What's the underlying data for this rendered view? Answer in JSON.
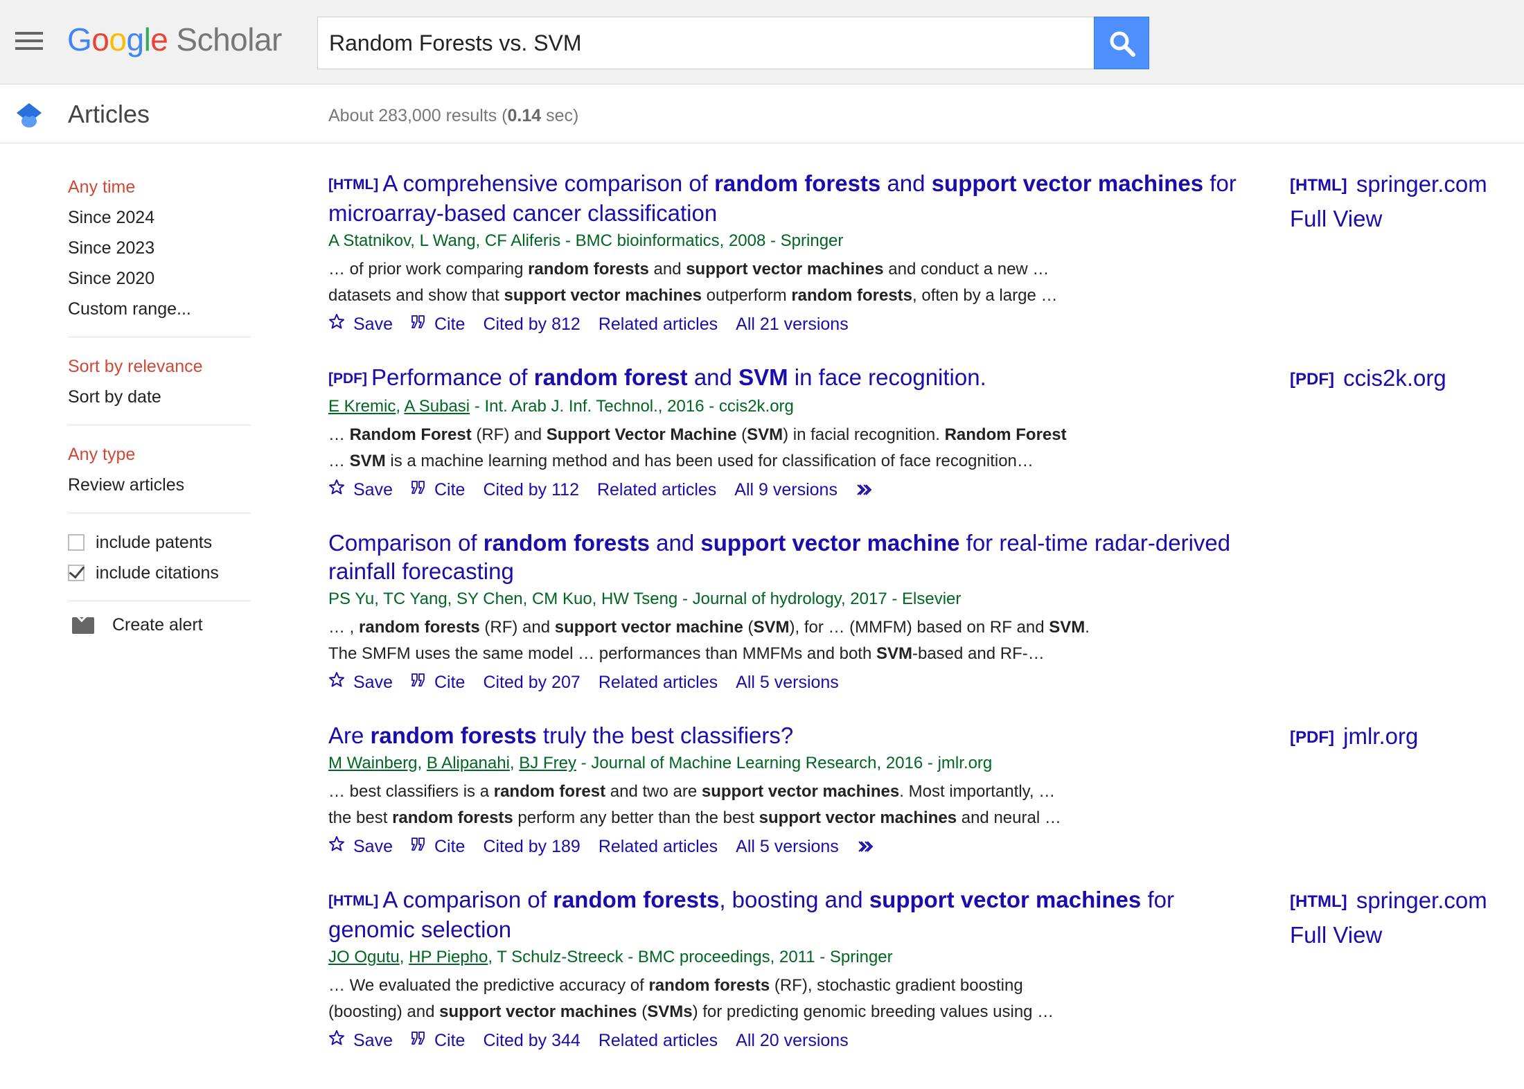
{
  "header": {
    "menu_icon": "hamburger-menu-icon",
    "logo": {
      "g1": "G",
      "o1": "o",
      "o2": "o",
      "g2": "g",
      "l": "l",
      "e": "e",
      "product": "Scholar"
    },
    "search_query": "Random Forests vs. SVM",
    "search_icon": "search-icon"
  },
  "subheader": {
    "section_icon": "scholar-cap-icon",
    "section": "Articles",
    "results_prefix": "About 283,000 results (",
    "results_time": "0.14",
    "results_suffix": " sec)"
  },
  "sidebar": {
    "time_filters": [
      "Any time",
      "Since 2024",
      "Since 2023",
      "Since 2020",
      "Custom range..."
    ],
    "sort_options": [
      "Sort by relevance",
      "Sort by date"
    ],
    "type_filters": [
      "Any type",
      "Review articles"
    ],
    "include_patents": "include patents",
    "include_citations": "include citations",
    "create_alert": "Create alert",
    "alert_icon": "envelope-icon"
  },
  "colors": {
    "link": "#1a0dab",
    "authors": "#006621",
    "active_filter": "#d14836",
    "search_button": "#4d90fe"
  },
  "results": [
    {
      "tag": "[HTML]",
      "title": [
        {
          "t": "A comprehensive comparison of ",
          "b": false
        },
        {
          "t": "random forests",
          "b": true
        },
        {
          "t": " and ",
          "b": false
        },
        {
          "t": "support vector machines",
          "b": true
        },
        {
          "t": " for microarray-based cancer classification",
          "b": false
        }
      ],
      "authors": [
        {
          "t": "A Statnikov, L Wang, CF Aliferis - BMC bioinformatics, 2008 - Springer",
          "u": false
        }
      ],
      "snippet_lines": [
        [
          {
            "t": "… of prior work comparing ",
            "b": false
          },
          {
            "t": "random forests",
            "b": true
          },
          {
            "t": " and ",
            "b": false
          },
          {
            "t": "support vector machines",
            "b": true
          },
          {
            "t": " and conduct a new …",
            "b": false
          }
        ],
        [
          {
            "t": "datasets and show that ",
            "b": false
          },
          {
            "t": "support vector machines",
            "b": true
          },
          {
            "t": " outperform ",
            "b": false
          },
          {
            "t": "random forests",
            "b": true
          },
          {
            "t": ", often by a large …",
            "b": false
          }
        ]
      ],
      "links": {
        "save": "Save",
        "cite": "Cite",
        "cited_by": "Cited by 812",
        "related": "Related articles",
        "versions": "All 21 versions",
        "more": false
      },
      "side": {
        "tag": "[HTML]",
        "source": "springer.com",
        "extra": "Full View"
      }
    },
    {
      "tag": "[PDF]",
      "title": [
        {
          "t": "Performance of ",
          "b": false
        },
        {
          "t": "random forest",
          "b": true
        },
        {
          "t": " and ",
          "b": false
        },
        {
          "t": "SVM",
          "b": true
        },
        {
          "t": " in face recognition.",
          "b": false
        }
      ],
      "authors": [
        {
          "t": "E Kremic",
          "u": true
        },
        {
          "t": ", ",
          "u": false
        },
        {
          "t": "A Subasi",
          "u": true
        },
        {
          "t": " - Int. Arab J. Inf. Technol., 2016 - ccis2k.org",
          "u": false
        }
      ],
      "snippet_lines": [
        [
          {
            "t": "… ",
            "b": false
          },
          {
            "t": "Random Forest",
            "b": true
          },
          {
            "t": " (RF) and ",
            "b": false
          },
          {
            "t": "Support Vector Machine",
            "b": true
          },
          {
            "t": " (",
            "b": false
          },
          {
            "t": "SVM",
            "b": true
          },
          {
            "t": ") in facial recognition. ",
            "b": false
          },
          {
            "t": "Random Forest",
            "b": true
          }
        ],
        [
          {
            "t": "… ",
            "b": false
          },
          {
            "t": "SVM",
            "b": true
          },
          {
            "t": " is a machine learning method and has been used for classification of face recognition…",
            "b": false
          }
        ]
      ],
      "links": {
        "save": "Save",
        "cite": "Cite",
        "cited_by": "Cited by 112",
        "related": "Related articles",
        "versions": "All 9 versions",
        "more": true
      },
      "side": {
        "tag": "[PDF]",
        "source": "ccis2k.org",
        "extra": ""
      }
    },
    {
      "tag": "",
      "title": [
        {
          "t": "Comparison of ",
          "b": false
        },
        {
          "t": "random forests",
          "b": true
        },
        {
          "t": " and ",
          "b": false
        },
        {
          "t": "support vector machine",
          "b": true
        },
        {
          "t": " for real-time radar-derived rainfall forecasting",
          "b": false
        }
      ],
      "authors": [
        {
          "t": "PS Yu, TC Yang, SY Chen, CM Kuo, HW Tseng - Journal of hydrology, 2017 - Elsevier",
          "u": false
        }
      ],
      "snippet_lines": [
        [
          {
            "t": "… , ",
            "b": false
          },
          {
            "t": "random forests",
            "b": true
          },
          {
            "t": " (RF) and ",
            "b": false
          },
          {
            "t": "support vector machine",
            "b": true
          },
          {
            "t": " (",
            "b": false
          },
          {
            "t": "SVM",
            "b": true
          },
          {
            "t": "), for … (MMFM) based on RF and ",
            "b": false
          },
          {
            "t": "SVM",
            "b": true
          },
          {
            "t": ".",
            "b": false
          }
        ],
        [
          {
            "t": "The SMFM uses the same model … performances than MMFMs and both ",
            "b": false
          },
          {
            "t": "SVM",
            "b": true
          },
          {
            "t": "-based and RF-…",
            "b": false
          }
        ]
      ],
      "links": {
        "save": "Save",
        "cite": "Cite",
        "cited_by": "Cited by 207",
        "related": "Related articles",
        "versions": "All 5 versions",
        "more": false
      },
      "side": null
    },
    {
      "tag": "",
      "title": [
        {
          "t": "Are ",
          "b": false
        },
        {
          "t": "random forests",
          "b": true
        },
        {
          "t": " truly the best classifiers?",
          "b": false
        }
      ],
      "authors": [
        {
          "t": "M Wainberg",
          "u": true
        },
        {
          "t": ", ",
          "u": false
        },
        {
          "t": "B Alipanahi",
          "u": true
        },
        {
          "t": ", ",
          "u": false
        },
        {
          "t": "BJ Frey",
          "u": true
        },
        {
          "t": " - Journal of Machine Learning Research, 2016 - jmlr.org",
          "u": false
        }
      ],
      "snippet_lines": [
        [
          {
            "t": "… best classifiers is a ",
            "b": false
          },
          {
            "t": "random forest",
            "b": true
          },
          {
            "t": " and two are ",
            "b": false
          },
          {
            "t": "support vector machines",
            "b": true
          },
          {
            "t": ". Most importantly, …",
            "b": false
          }
        ],
        [
          {
            "t": "the best ",
            "b": false
          },
          {
            "t": "random forests",
            "b": true
          },
          {
            "t": " perform any better than the best ",
            "b": false
          },
          {
            "t": "support vector machines",
            "b": true
          },
          {
            "t": " and neural …",
            "b": false
          }
        ]
      ],
      "links": {
        "save": "Save",
        "cite": "Cite",
        "cited_by": "Cited by 189",
        "related": "Related articles",
        "versions": "All 5 versions",
        "more": true
      },
      "side": {
        "tag": "[PDF]",
        "source": "jmlr.org",
        "extra": ""
      }
    },
    {
      "tag": "[HTML]",
      "title": [
        {
          "t": "A comparison of ",
          "b": false
        },
        {
          "t": "random forests",
          "b": true
        },
        {
          "t": ", boosting and ",
          "b": false
        },
        {
          "t": "support vector machines",
          "b": true
        },
        {
          "t": " for genomic selection",
          "b": false
        }
      ],
      "authors": [
        {
          "t": "JO Ogutu",
          "u": true
        },
        {
          "t": ", ",
          "u": false
        },
        {
          "t": "HP Piepho",
          "u": true
        },
        {
          "t": ", T Schulz-Streeck - BMC proceedings, 2011 - Springer",
          "u": false
        }
      ],
      "snippet_lines": [
        [
          {
            "t": "… We evaluated the predictive accuracy of ",
            "b": false
          },
          {
            "t": "random forests",
            "b": true
          },
          {
            "t": " (RF), stochastic gradient boosting",
            "b": false
          }
        ],
        [
          {
            "t": "(boosting) and ",
            "b": false
          },
          {
            "t": "support vector machines",
            "b": true
          },
          {
            "t": " (",
            "b": false
          },
          {
            "t": "SVMs",
            "b": true
          },
          {
            "t": ") for predicting genomic breeding values using …",
            "b": false
          }
        ]
      ],
      "links": {
        "save": "Save",
        "cite": "Cite",
        "cited_by": "Cited by 344",
        "related": "Related articles",
        "versions": "All 20 versions",
        "more": false
      },
      "side": {
        "tag": "[HTML]",
        "source": "springer.com",
        "extra": "Full View"
      }
    }
  ]
}
